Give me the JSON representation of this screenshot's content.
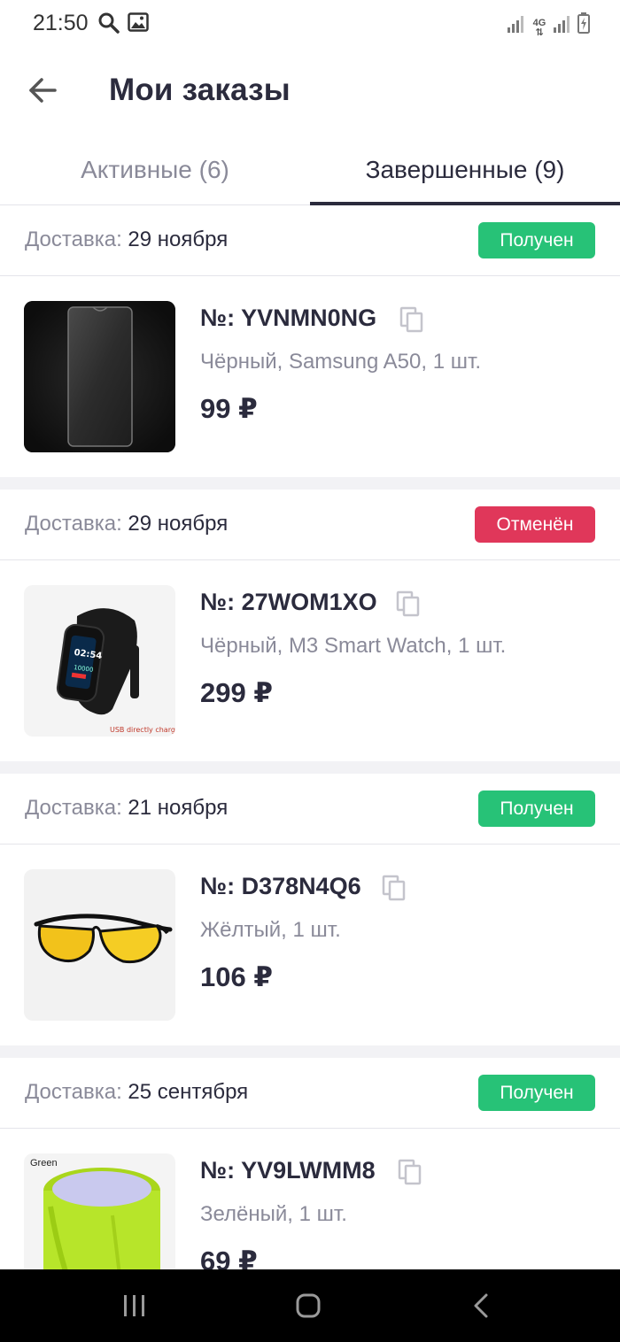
{
  "status_bar": {
    "time": "21:50",
    "network": "4G"
  },
  "header": {
    "title": "Мои заказы"
  },
  "tabs": [
    {
      "label": "Активные (6)",
      "active": false
    },
    {
      "label": "Завершенные (9)",
      "active": true
    }
  ],
  "orders": [
    {
      "delivery_label": "Доставка:",
      "delivery_date": "29 ноября",
      "status": "Получен",
      "number": "№: YVNMN0NG",
      "description": "Чёрный, Samsung A50, 1 шт.",
      "price": "99 ₽",
      "image": "screen-protector"
    },
    {
      "delivery_label": "Доставка:",
      "delivery_date": "29 ноября",
      "status": "Отменён",
      "number": "№: 27WOM1XO",
      "description": "Чёрный, M3 Smart Watch, 1 шт.",
      "price": "299 ₽",
      "image": "smart-watch",
      "image_caption": "USB directly charging",
      "watch_time": "02:54",
      "watch_steps": "10000"
    },
    {
      "delivery_label": "Доставка:",
      "delivery_date": "21 ноября",
      "status": "Получен",
      "number": "№: D378N4Q6",
      "description": "Жёлтый, 1 шт.",
      "price": "106 ₽",
      "image": "sunglasses"
    },
    {
      "delivery_label": "Доставка:",
      "delivery_date": "25 сентября",
      "status": "Получен",
      "number": "№: YV9LWMM8",
      "description": "Зелёный, 1 шт.",
      "price": "69 ₽",
      "image": "green-band",
      "image_caption": "Green"
    }
  ],
  "colors": {
    "status_ok": "#27c277",
    "status_cancel": "#e0375a",
    "text_primary": "#2b2b3d",
    "text_secondary": "#8a8a99"
  },
  "icons": [
    "back-arrow-icon",
    "search-icon",
    "gallery-icon",
    "signal-icon",
    "battery-icon",
    "copy-icon",
    "recents-icon",
    "home-icon",
    "nav-back-icon"
  ]
}
